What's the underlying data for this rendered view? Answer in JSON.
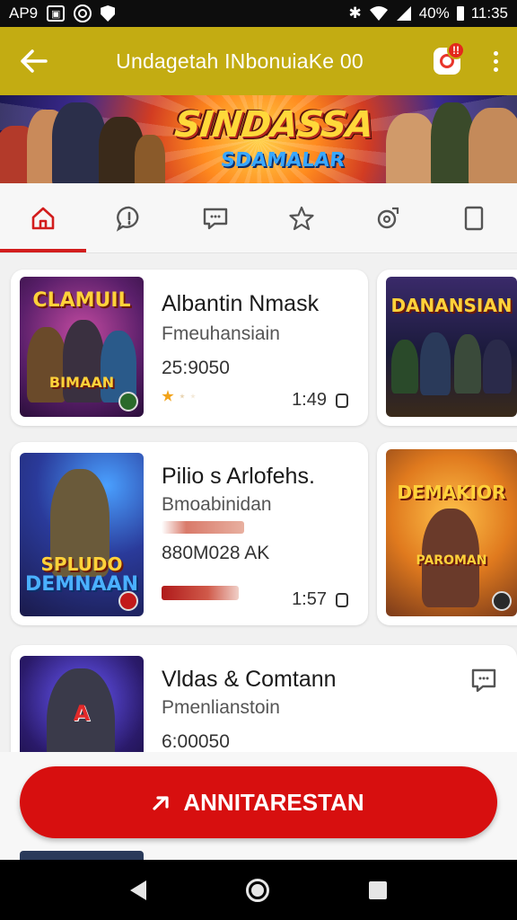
{
  "status_bar": {
    "carrier": "AP9",
    "battery": "40%",
    "time": "11:35"
  },
  "toolbar": {
    "title": "Undagetah INbonuiaKe 00",
    "notification_count": "!!"
  },
  "banner": {
    "title": "SINDASSA",
    "subtitle": "SDAMALAR"
  },
  "tabs": [
    {
      "icon": "home-icon",
      "active": true
    },
    {
      "icon": "chat-alert-icon",
      "active": false
    },
    {
      "icon": "message-icon",
      "active": false
    },
    {
      "icon": "star-icon",
      "active": false
    },
    {
      "icon": "settings-icon",
      "active": false
    },
    {
      "icon": "square-icon",
      "active": false
    }
  ],
  "cards": [
    {
      "title": "Albantin Nmask",
      "subtitle": "Fmeuhansiain",
      "stat": "25:9050",
      "time": "1:49",
      "thumb_label": "CLAMUIL",
      "thumb_label_bottom": "BIMAAN"
    },
    {
      "title": "Pilio s Arlofehs.",
      "subtitle": "Bmoabinidan",
      "stat": "880M028 AK",
      "time": "1:57",
      "thumb_label": "SPLUDO",
      "thumb_label_bottom": "DEMNAAN"
    },
    {
      "title": "Vldas & Comtann",
      "subtitle": "Pmenlianstoin",
      "stat": "6:00050",
      "thumb_label": "A"
    }
  ],
  "side_cards": [
    {
      "label": "DANANSIAN"
    },
    {
      "label": "DEMAKIOR",
      "label_bottom": "PAROMAN"
    }
  ],
  "cta": {
    "label": "ANNITARESTAN"
  },
  "colors": {
    "toolbar": "#c3ac12",
    "accent": "#d70f0f",
    "tab_indicator": "#d21d1d"
  }
}
